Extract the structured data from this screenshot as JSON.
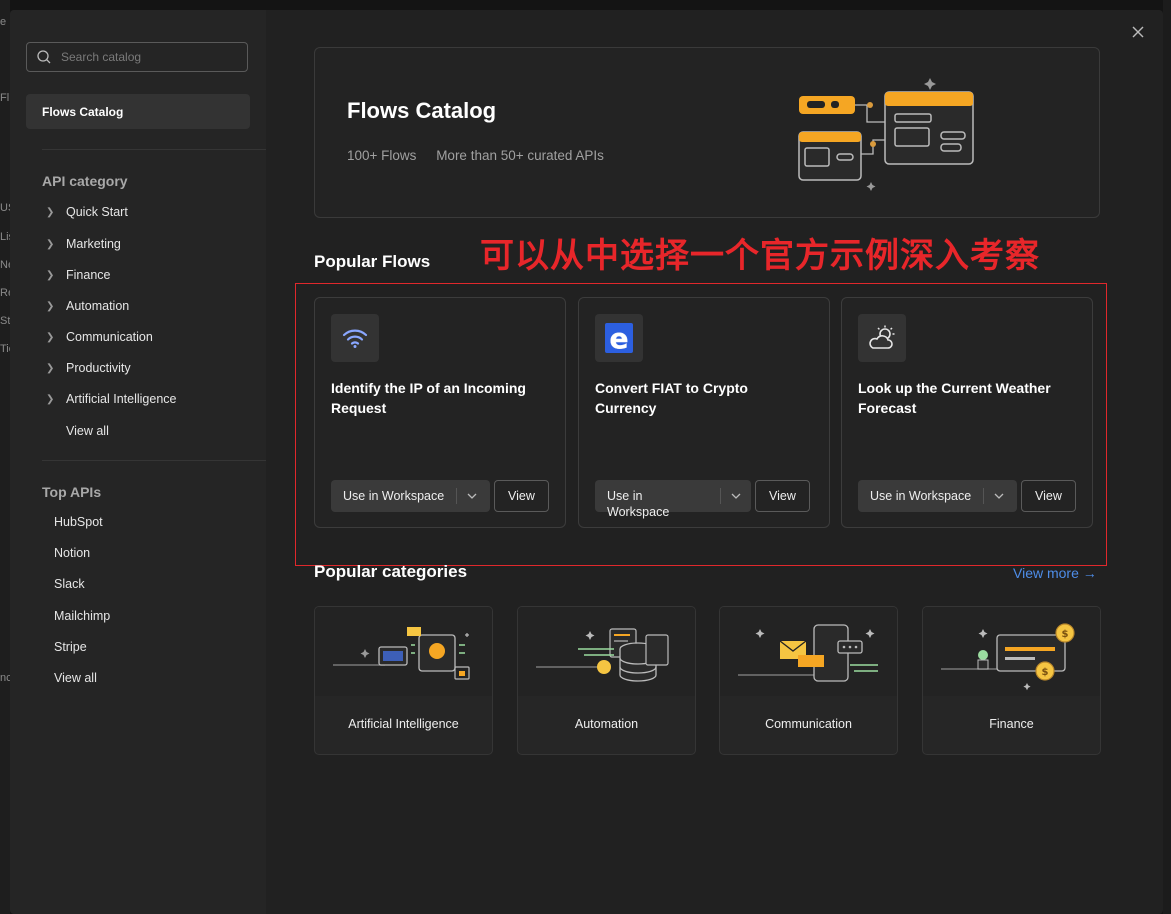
{
  "background": {
    "left_fragments": [
      "e",
      "Fl",
      "US",
      "Lis",
      "Ne",
      "Re",
      "St",
      "Tie",
      "nc"
    ]
  },
  "sidebar": {
    "search_placeholder": "Search catalog",
    "active_item": "Flows Catalog",
    "api_category_title": "API category",
    "categories": [
      "Quick Start",
      "Marketing",
      "Finance",
      "Automation",
      "Communication",
      "Productivity",
      "Artificial Intelligence"
    ],
    "categories_view_all": "View all",
    "top_apis_title": "Top APIs",
    "top_apis": [
      "HubSpot",
      "Notion",
      "Slack",
      "Mailchimp",
      "Stripe"
    ],
    "top_apis_view_all": "View all"
  },
  "hero": {
    "title": "Flows Catalog",
    "stat_flows": "100+ Flows",
    "stat_apis": "More than 50+ curated APIs"
  },
  "annotation": "可以从中选择一个官方示例深入考察",
  "popular_flows": {
    "title": "Popular Flows",
    "cards": [
      {
        "title": "Identify the IP of an Incoming Request",
        "icon": "wifi-icon",
        "use_label": "Use in Workspace",
        "view_label": "View"
      },
      {
        "title": "Convert FIAT to Crypto Currency",
        "icon": "e-logo-icon",
        "use_label": "Use in Workspace",
        "view_label": "View"
      },
      {
        "title": "Look up the Current Weather Forecast",
        "icon": "weather-icon",
        "use_label": "Use in Workspace",
        "view_label": "View"
      }
    ]
  },
  "popular_categories": {
    "title": "Popular categories",
    "view_more": "View more →",
    "cards": [
      "Artificial Intelligence",
      "Automation",
      "Communication",
      "Finance"
    ]
  },
  "colors": {
    "accent_orange": "#f5a623",
    "link_blue": "#4e8de8",
    "annotation_red": "#e8262a"
  }
}
